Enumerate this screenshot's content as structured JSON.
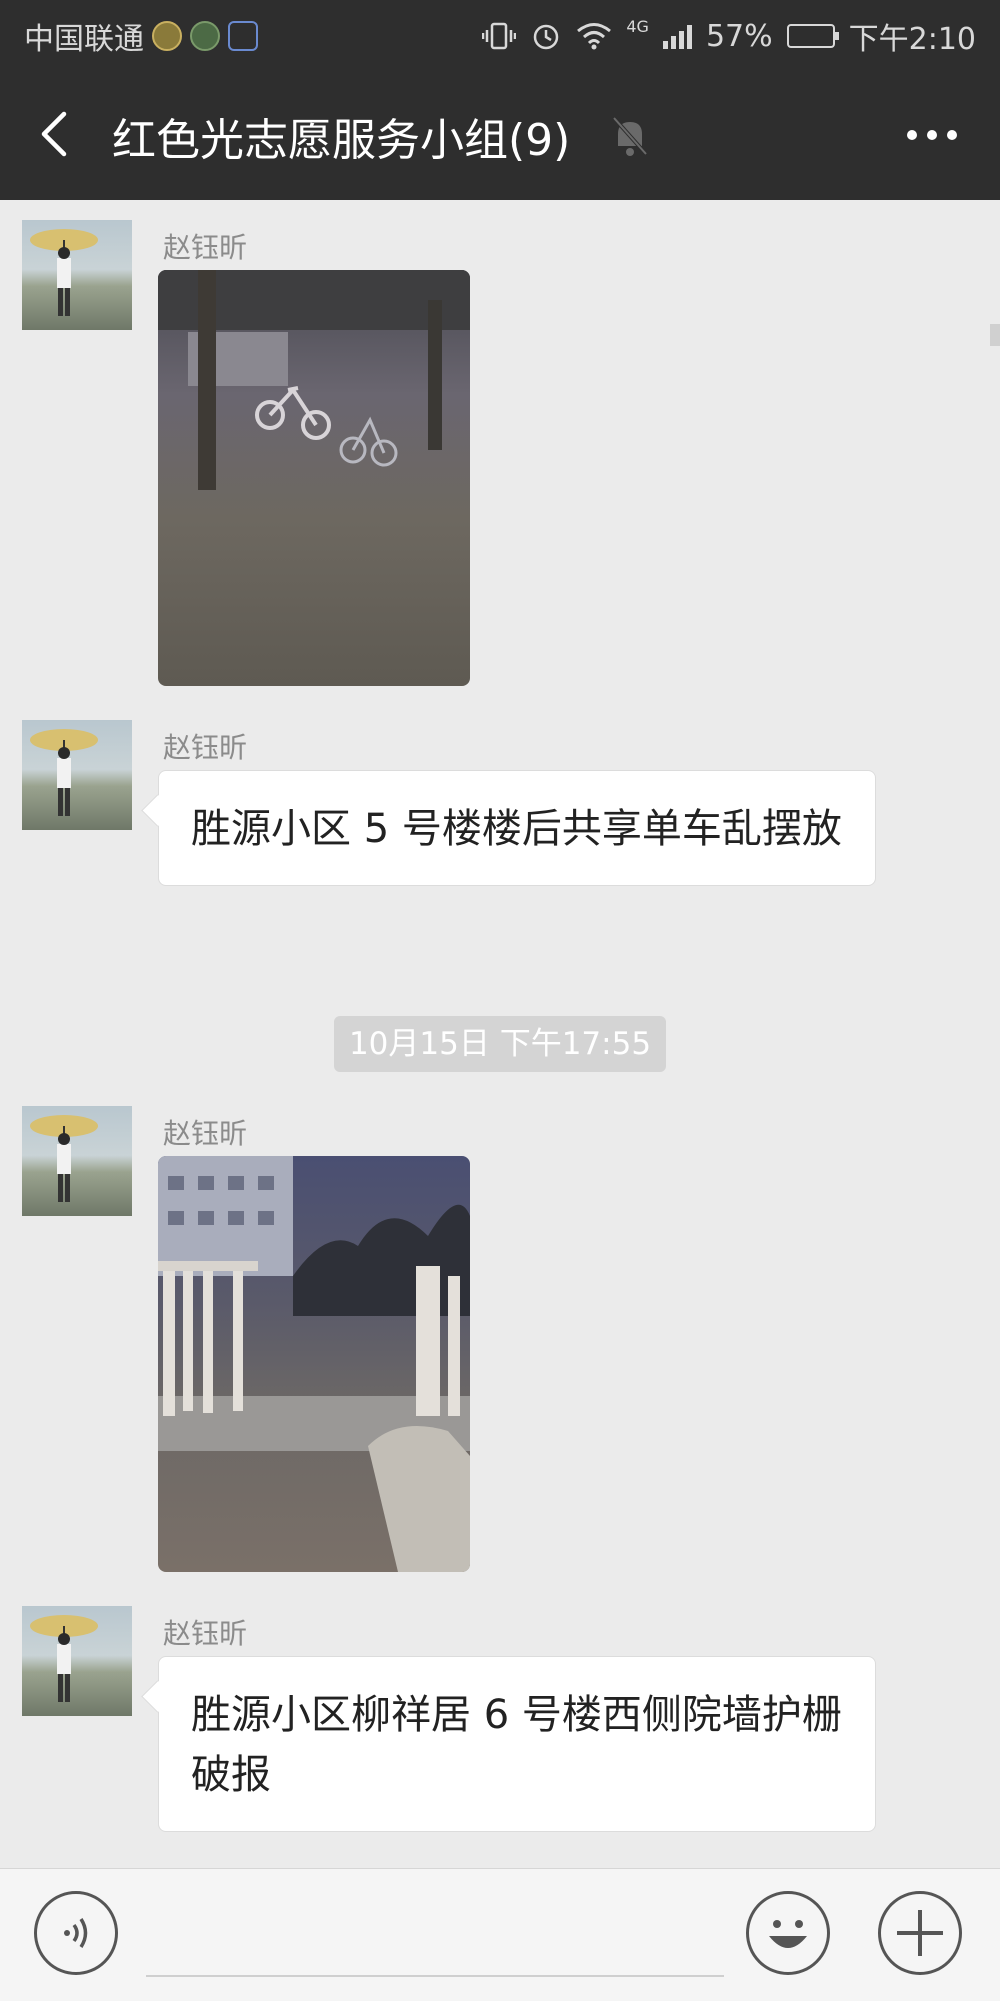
{
  "status_bar": {
    "carrier": "中国联通",
    "network": "4G",
    "battery": "57%",
    "time": "下午2:10"
  },
  "header": {
    "title": "红色光志愿服务小组(9)",
    "back_icon": "back-arrow-icon",
    "mute_icon": "bell-muted-icon",
    "more_icon": "more-dots-icon"
  },
  "messages": [
    {
      "type": "image",
      "sender": "赵钰昕",
      "description": "photo-bikes-at-night"
    },
    {
      "type": "text",
      "sender": "赵钰昕",
      "text": "胜源小区 5 号楼楼后共享单车乱摆放"
    },
    {
      "type": "timestamp",
      "text": "10月15日 下午17:55"
    },
    {
      "type": "image",
      "sender": "赵钰昕",
      "description": "photo-broken-fence"
    },
    {
      "type": "text",
      "sender": "赵钰昕",
      "text": "胜源小区柳祥居 6 号楼西侧院墙护栅破报"
    }
  ],
  "input_bar": {
    "voice_icon": "voice-icon",
    "emoji_icon": "emoji-icon",
    "plus_icon": "plus-icon"
  }
}
